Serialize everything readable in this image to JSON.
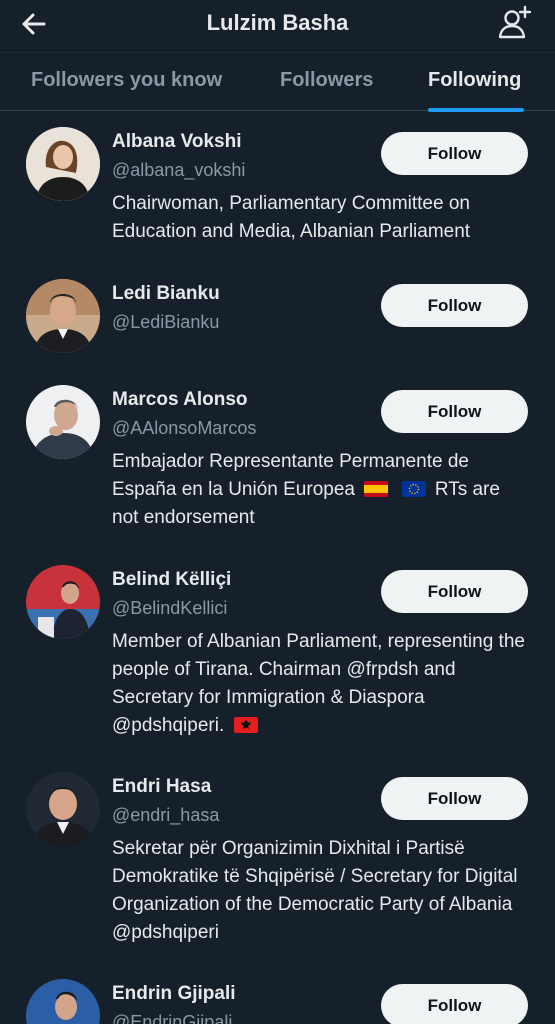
{
  "header": {
    "title": "Lulzim Basha",
    "back_icon": "arrow-left-icon",
    "add_icon": "add-user-icon"
  },
  "tabs": [
    {
      "label": "Followers you know",
      "active": false
    },
    {
      "label": "Followers",
      "active": false
    },
    {
      "label": "Following",
      "active": true
    }
  ],
  "colors": {
    "background": "#15202b",
    "accent": "#1d9bf0",
    "secondary_text": "#8b98a5",
    "button_bg": "#eff3f4"
  },
  "users": [
    {
      "name": "Albana Vokshi",
      "handle": "@albana_vokshi",
      "follow_label": "Follow",
      "bio": "Chairwoman, Parliamentary Committee on Education and Media, Albanian Parliament"
    },
    {
      "name": "Ledi Bianku",
      "handle": "@LediBianku",
      "follow_label": "Follow",
      "bio": ""
    },
    {
      "name": "Marcos Alonso",
      "handle": "@AAlonsoMarcos",
      "follow_label": "Follow",
      "bio_lines": [
        "Embajador Representante Permanente de",
        "España en la Unión Europea",
        "RTs are",
        "not endorsement"
      ],
      "bio_flags": [
        "spain-flag",
        "eu-flag"
      ]
    },
    {
      "name": "Belind Këlliçi",
      "handle": "@BelindKellici",
      "follow_label": "Follow",
      "bio": "Member of Albanian Parliament, representing the people of Tirana. Chairman @frpdsh and Secretary for Immigration & Diaspora @pdshqiperi.",
      "bio_flags": [
        "albania-flag"
      ]
    },
    {
      "name": "Endri Hasa",
      "handle": "@endri_hasa",
      "follow_label": "Follow",
      "bio": "Sekretar për Organizimin Dixhital i Partisë Demokratike të Shqipërisë / Secretary for Digital Organization of the Democratic Party of Albania @pdshqiperi"
    },
    {
      "name": "Endrin Gjipali",
      "handle": "@EndrinGjipali",
      "follow_label": "Follow",
      "bio": ""
    }
  ]
}
